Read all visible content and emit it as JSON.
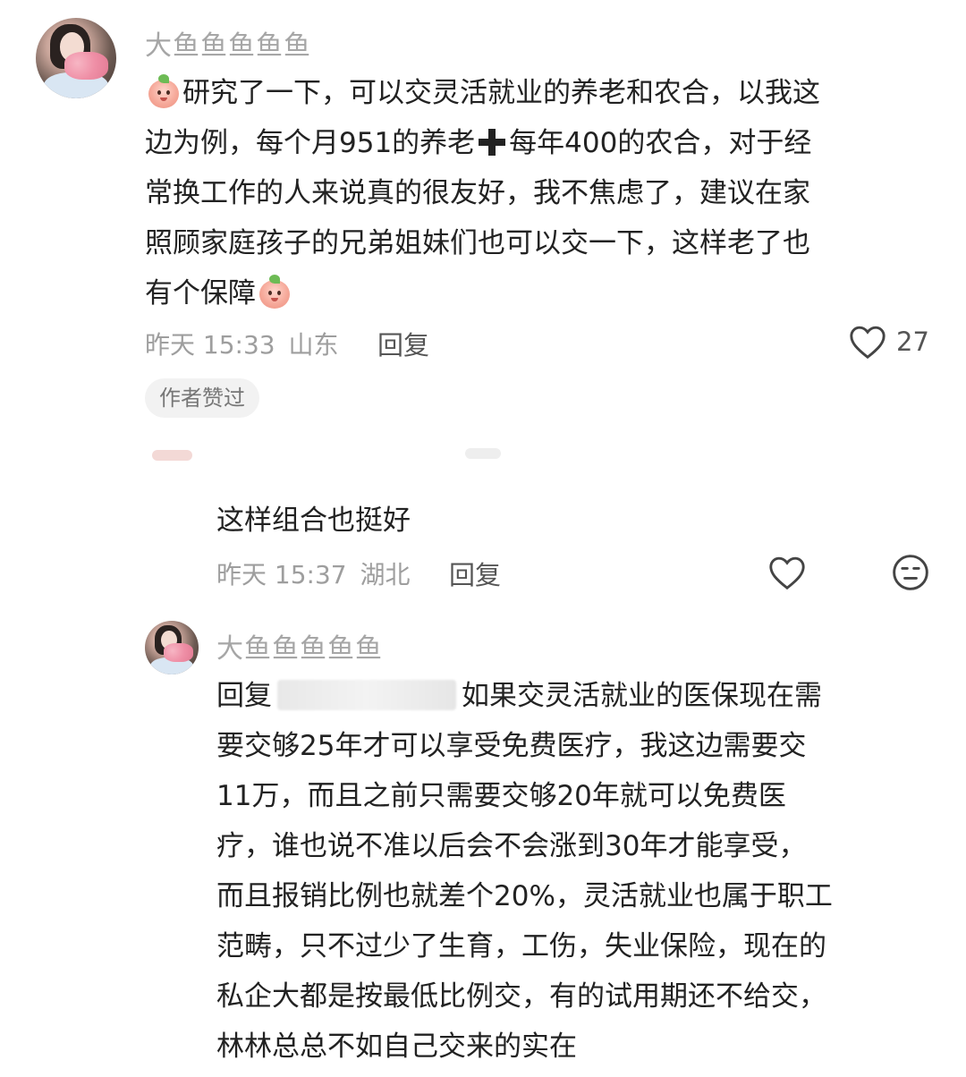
{
  "comment1": {
    "username": "大鱼鱼鱼鱼鱼",
    "text_parts": {
      "l1": "研究了一下，可以交灵活就业的养老和农合，以我这",
      "l2a": "边为例，每个月951的养老",
      "l2b": "每年400的农合，对于经",
      "l3": "常换工作的人来说真的很友好，我不焦虑了，建议在家",
      "l4": "照顾家庭孩子的兄弟姐妹们也可以交一下，这样老了也",
      "l5": "有个保障"
    },
    "time": "昨天 15:33",
    "location": "山东",
    "reply_label": "回复",
    "likes": "27",
    "author_badge": "作者赞过"
  },
  "reply1": {
    "text": "这样组合也挺好",
    "time": "昨天 15:37",
    "location": "湖北",
    "reply_label": "回复"
  },
  "reply2": {
    "username": "大鱼鱼鱼鱼鱼",
    "prefix": "回复",
    "lines": {
      "l1": "如果交灵活就业的医保现在需",
      "l2": "要交够25年才可以享受免费医疗，我这边需要交",
      "l3": "11万，而且之前只需要交够20年就可以免费医",
      "l4": "疗，谁也说不准以后会不会涨到30年才能享受，",
      "l5": "而且报销比例也就差个20%，灵活就业也属于职工",
      "l6": "范畴，只不过少了生育，工伤，失业保险，现在的",
      "l7": "私企大都是按最低比例交，有的试用期还不给交，",
      "l8": "林林总总不如自己交来的实在"
    }
  },
  "icons": {
    "heart": "heart-icon",
    "dislike": "dislike-face-icon",
    "emoji": "peach-emoji-icon",
    "plus": "heavy-plus-icon"
  },
  "colors": {
    "text": "#222222",
    "muted": "#9e9e9e",
    "username": "#a6a6a6",
    "badge_bg": "#f2f2f2"
  }
}
